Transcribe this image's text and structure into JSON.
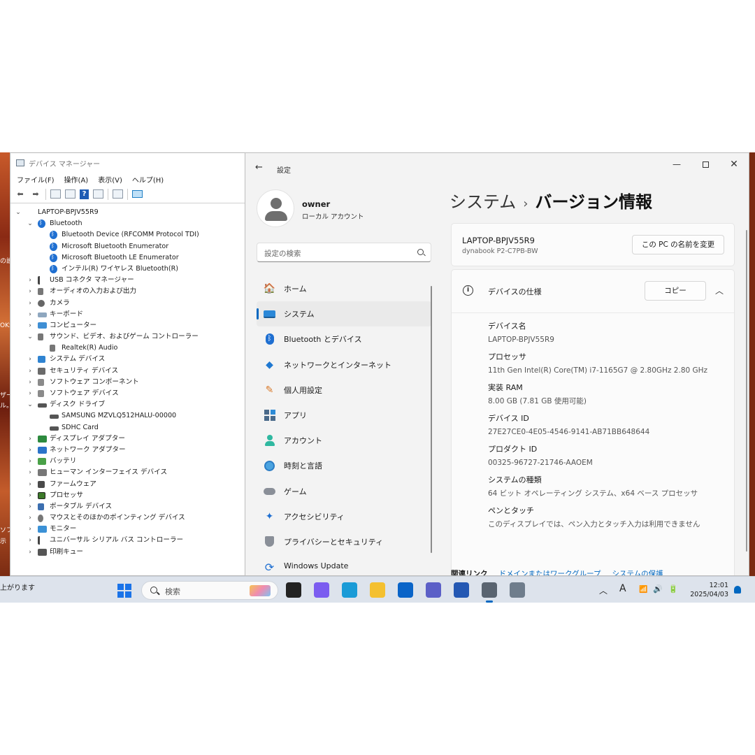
{
  "desktop": {
    "side_texts": [
      "の設",
      "OKS",
      "ザー",
      "ル。",
      "ソフ",
      "示"
    ],
    "notification_text": "上がります"
  },
  "device_manager": {
    "title": "デバイス マネージャー",
    "menu": [
      "ファイル(F)",
      "操作(A)",
      "表示(V)",
      "ヘルプ(H)"
    ],
    "tree": [
      {
        "label": "LAPTOP-BPJV55R9",
        "level": 0,
        "expander": "⌄",
        "icon": "computer"
      },
      {
        "label": "Bluetooth",
        "level": 1,
        "expander": "⌄",
        "icon": "bt"
      },
      {
        "label": "Bluetooth Device (RFCOMM Protocol TDI)",
        "level": 2,
        "expander": "",
        "icon": "bt"
      },
      {
        "label": "Microsoft Bluetooth Enumerator",
        "level": 2,
        "expander": "",
        "icon": "bt"
      },
      {
        "label": "Microsoft Bluetooth LE Enumerator",
        "level": 2,
        "expander": "",
        "icon": "bt"
      },
      {
        "label": "インテル(R) ワイヤレス Bluetooth(R)",
        "level": 2,
        "expander": "",
        "icon": "bt"
      },
      {
        "label": "USB コネクタ マネージャー",
        "level": 1,
        "expander": "›",
        "icon": "usb"
      },
      {
        "label": "オーディオの入力および出力",
        "level": 1,
        "expander": "›",
        "icon": "spk"
      },
      {
        "label": "カメラ",
        "level": 1,
        "expander": "›",
        "icon": "cam"
      },
      {
        "label": "キーボード",
        "level": 1,
        "expander": "›",
        "icon": "kbd"
      },
      {
        "label": "コンピューター",
        "level": 1,
        "expander": "›",
        "icon": "pc"
      },
      {
        "label": "サウンド、ビデオ、およびゲーム コントローラー",
        "level": 1,
        "expander": "⌄",
        "icon": "spk"
      },
      {
        "label": "Realtek(R) Audio",
        "level": 2,
        "expander": "",
        "icon": "spk"
      },
      {
        "label": "システム デバイス",
        "level": 1,
        "expander": "›",
        "icon": "sys"
      },
      {
        "label": "セキュリティ デバイス",
        "level": 1,
        "expander": "›",
        "icon": "sec"
      },
      {
        "label": "ソフトウェア コンポーネント",
        "level": 1,
        "expander": "›",
        "icon": "sw"
      },
      {
        "label": "ソフトウェア デバイス",
        "level": 1,
        "expander": "›",
        "icon": "sw"
      },
      {
        "label": "ディスク ドライブ",
        "level": 1,
        "expander": "⌄",
        "icon": "disk"
      },
      {
        "label": "SAMSUNG MZVLQ512HALU-00000",
        "level": 2,
        "expander": "",
        "icon": "disk"
      },
      {
        "label": "SDHC Card",
        "level": 2,
        "expander": "",
        "icon": "disk"
      },
      {
        "label": "ディスプレイ アダプター",
        "level": 1,
        "expander": "›",
        "icon": "disp"
      },
      {
        "label": "ネットワーク アダプター",
        "level": 1,
        "expander": "›",
        "icon": "net"
      },
      {
        "label": "バッテリ",
        "level": 1,
        "expander": "›",
        "icon": "bat"
      },
      {
        "label": "ヒューマン インターフェイス デバイス",
        "level": 1,
        "expander": "›",
        "icon": "hid"
      },
      {
        "label": "ファームウェア",
        "level": 1,
        "expander": "›",
        "icon": "fw"
      },
      {
        "label": "プロセッサ",
        "level": 1,
        "expander": "›",
        "icon": "cpu"
      },
      {
        "label": "ポータブル デバイス",
        "level": 1,
        "expander": "›",
        "icon": "port"
      },
      {
        "label": "マウスとそのほかのポインティング デバイス",
        "level": 1,
        "expander": "›",
        "icon": "mouse"
      },
      {
        "label": "モニター",
        "level": 1,
        "expander": "›",
        "icon": "mon"
      },
      {
        "label": "ユニバーサル シリアル バス コントローラー",
        "level": 1,
        "expander": "›",
        "icon": "usb"
      },
      {
        "label": "印刷キュー",
        "level": 1,
        "expander": "›",
        "icon": "prn"
      }
    ]
  },
  "settings": {
    "app_title": "設定",
    "user": {
      "name": "owner",
      "account_type": "ローカル アカウント"
    },
    "search_placeholder": "設定の検索",
    "nav": [
      {
        "label": "ホーム",
        "icon": "home-icon",
        "selected": false
      },
      {
        "label": "システム",
        "icon": "system-icon",
        "selected": true
      },
      {
        "label": "Bluetooth とデバイス",
        "icon": "bluetooth-icon",
        "selected": false
      },
      {
        "label": "ネットワークとインターネット",
        "icon": "wifi-icon",
        "selected": false
      },
      {
        "label": "個人用設定",
        "icon": "brush-icon",
        "selected": false
      },
      {
        "label": "アプリ",
        "icon": "apps-icon",
        "selected": false
      },
      {
        "label": "アカウント",
        "icon": "account-icon",
        "selected": false
      },
      {
        "label": "時刻と言語",
        "icon": "globe-clock-icon",
        "selected": false
      },
      {
        "label": "ゲーム",
        "icon": "gamepad-icon",
        "selected": false
      },
      {
        "label": "アクセシビリティ",
        "icon": "accessibility-icon",
        "selected": false
      },
      {
        "label": "プライバシーとセキュリティ",
        "icon": "shield-icon",
        "selected": false
      },
      {
        "label": "Windows Update",
        "icon": "update-icon",
        "selected": false
      }
    ],
    "breadcrumb": {
      "parent": "システム",
      "separator": "›",
      "current": "バージョン情報"
    },
    "device_card": {
      "name": "LAPTOP-BPJV55R9",
      "model": "dynabook P2-C7PB-BW",
      "rename_button": "この PC の名前を変更"
    },
    "spec_card": {
      "title": "デバイスの仕様",
      "copy_button": "コピー",
      "specs": [
        {
          "label": "デバイス名",
          "value": "LAPTOP-BPJV55R9"
        },
        {
          "label": "プロセッサ",
          "value": "11th Gen Intel(R) Core(TM) i7-1165G7 @ 2.80GHz   2.80 GHz"
        },
        {
          "label": "実装 RAM",
          "value": "8.00 GB (7.81 GB 使用可能)"
        },
        {
          "label": "デバイス ID",
          "value": "27E27CE0-4E05-4546-9141-AB71BB648644"
        },
        {
          "label": "プロダクト ID",
          "value": "00325-96727-21746-AAOEM"
        },
        {
          "label": "システムの種類",
          "value": "64 ビット オペレーティング システム、x64 ベース プロセッサ"
        },
        {
          "label": "ペンとタッチ",
          "value": "このディスプレイでは、ペン入力とタッチ入力は利用できません"
        }
      ]
    },
    "related": {
      "label": "関連リンク",
      "links": [
        "ドメインまたはワークグループ",
        "システムの保護"
      ]
    }
  },
  "taskbar": {
    "search_label": "検索",
    "ime_indicator": "A",
    "time": "12:01",
    "date": "2025/04/03",
    "apps": [
      {
        "name": "task-view-icon",
        "color": "#222222",
        "active": false
      },
      {
        "name": "copilot-icon",
        "color": "#7b5cf0",
        "active": false
      },
      {
        "name": "edge-icon",
        "color": "#1a9bd7",
        "active": false
      },
      {
        "name": "file-explorer-icon",
        "color": "#f4c030",
        "active": false
      },
      {
        "name": "outlook-icon",
        "color": "#0a64c8",
        "active": false
      },
      {
        "name": "teams-icon",
        "color": "#5b5fc7",
        "active": false
      },
      {
        "name": "store-icon",
        "color": "#2458b3",
        "active": false
      },
      {
        "name": "settings-icon",
        "color": "#5a6470",
        "active": true
      },
      {
        "name": "device-manager-icon",
        "color": "#6f7d8c",
        "active": false
      }
    ]
  }
}
